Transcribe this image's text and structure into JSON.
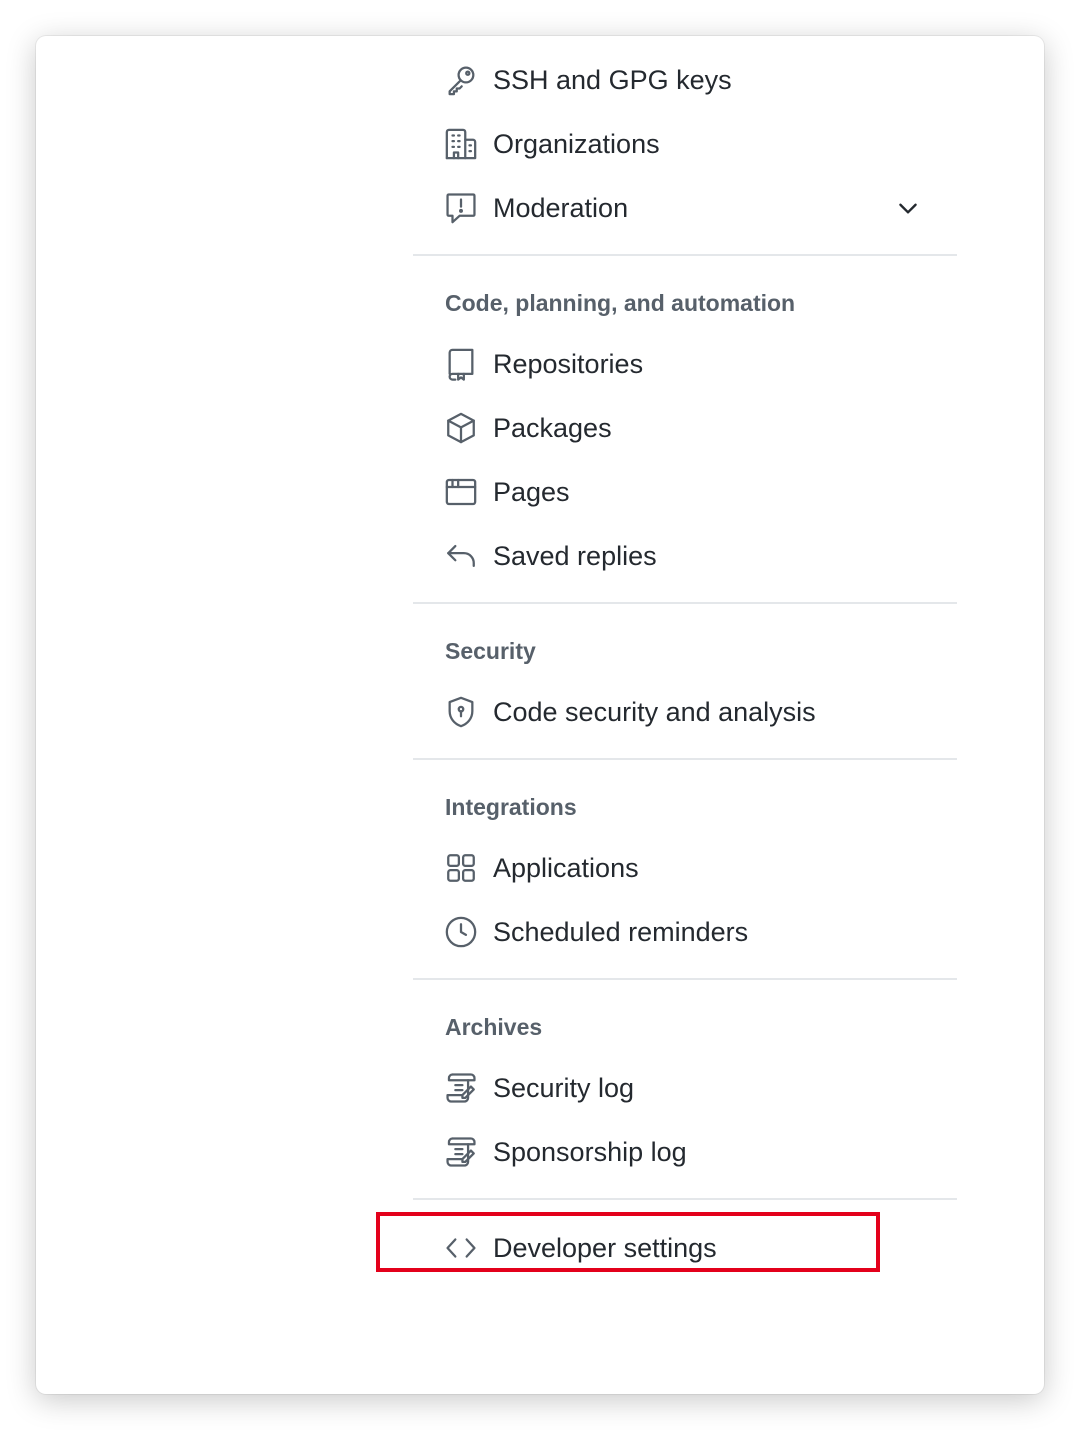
{
  "menu": {
    "top_items": [
      {
        "label": "SSH and GPG keys",
        "icon": "key-icon"
      },
      {
        "label": "Organizations",
        "icon": "organization-icon"
      },
      {
        "label": "Moderation",
        "icon": "report-icon",
        "expandable": true
      }
    ],
    "sections": [
      {
        "heading": "Code, planning, and automation",
        "items": [
          {
            "label": "Repositories",
            "icon": "repo-icon"
          },
          {
            "label": "Packages",
            "icon": "package-icon"
          },
          {
            "label": "Pages",
            "icon": "browser-icon"
          },
          {
            "label": "Saved replies",
            "icon": "reply-icon"
          }
        ]
      },
      {
        "heading": "Security",
        "items": [
          {
            "label": "Code security and analysis",
            "icon": "shield-lock-icon"
          }
        ]
      },
      {
        "heading": "Integrations",
        "items": [
          {
            "label": "Applications",
            "icon": "apps-icon"
          },
          {
            "label": "Scheduled reminders",
            "icon": "clock-icon"
          }
        ]
      },
      {
        "heading": "Archives",
        "items": [
          {
            "label": "Security log",
            "icon": "log-icon"
          },
          {
            "label": "Sponsorship log",
            "icon": "log-icon"
          }
        ]
      }
    ],
    "bottom_item": {
      "label": "Developer settings",
      "icon": "code-icon",
      "highlighted": true
    }
  },
  "colors": {
    "text": "#24292f",
    "muted": "#57606a",
    "divider": "#e4e7ea",
    "highlight": "#e3001b"
  }
}
